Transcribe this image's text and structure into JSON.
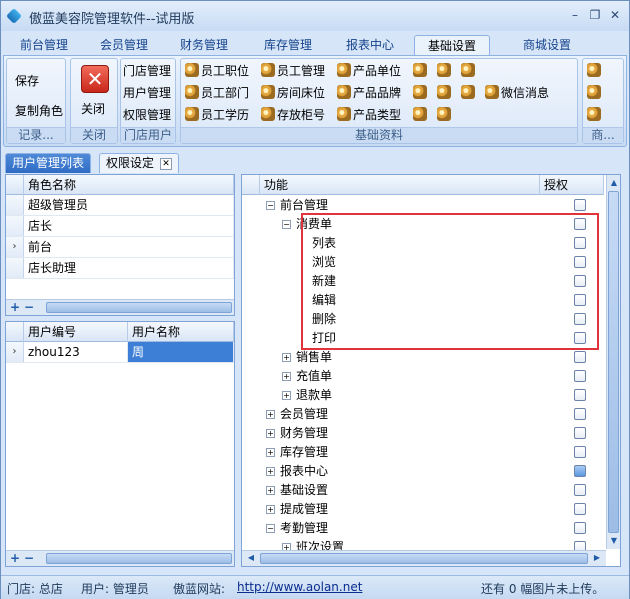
{
  "window": {
    "title": "傲蓝美容院管理软件--试用版",
    "minimize": "–",
    "restore": "❐",
    "close": "✕"
  },
  "ribbon_tabs": [
    "前台管理",
    "会员管理",
    "财务管理",
    "库存管理",
    "报表中心",
    "基础设置",
    "商城设置"
  ],
  "ribbon_active_tab": "基础设置",
  "ribbon": {
    "record_group": {
      "save": "保存",
      "copy_role": "复制角色",
      "label": "记录..."
    },
    "close_group": {
      "close": "关闭",
      "label": "关闭"
    },
    "store_group": {
      "items": [
        "门店管理",
        "用户管理",
        "权限管理"
      ],
      "label": "门店用户"
    },
    "basic_group": {
      "row1": [
        "员工职位",
        "员工管理",
        "产品单位",
        "",
        "",
        ""
      ],
      "row2": [
        "员工部门",
        "房间床位",
        "产品品牌",
        "",
        "",
        "微信消息"
      ],
      "row3": [
        "员工学历",
        "存放柜号",
        "产品类型",
        "",
        ""
      ],
      "label": "基础资料"
    },
    "mall_group": {
      "label": "商..."
    }
  },
  "doc_tabs": {
    "user_list": "用户管理列表",
    "permission": "权限设定"
  },
  "role_grid": {
    "header": "角色名称",
    "rows": [
      "超级管理员",
      "店长",
      "前台",
      "店长助理"
    ],
    "selected_marker": "›"
  },
  "user_grid": {
    "headers": [
      "用户编号",
      "用户名称"
    ],
    "rows": [
      {
        "code": "zhou123",
        "name": "周"
      }
    ]
  },
  "grid_controls": {
    "add": "+",
    "remove": "−"
  },
  "tree": {
    "headers": {
      "function": "功能",
      "auth": "授权"
    },
    "nodes": [
      {
        "label": "前台管理",
        "level": 0,
        "exp": "−"
      },
      {
        "label": "消费单",
        "level": 1,
        "exp": "−"
      },
      {
        "label": "列表",
        "level": 2,
        "exp": ""
      },
      {
        "label": "浏览",
        "level": 2,
        "exp": ""
      },
      {
        "label": "新建",
        "level": 2,
        "exp": ""
      },
      {
        "label": "编辑",
        "level": 2,
        "exp": ""
      },
      {
        "label": "删除",
        "level": 2,
        "exp": ""
      },
      {
        "label": "打印",
        "level": 2,
        "exp": ""
      },
      {
        "label": "销售单",
        "level": 1,
        "exp": "+"
      },
      {
        "label": "充值单",
        "level": 1,
        "exp": "+"
      },
      {
        "label": "退款单",
        "level": 1,
        "exp": "+"
      },
      {
        "label": "会员管理",
        "level": 0,
        "exp": "+"
      },
      {
        "label": "财务管理",
        "level": 0,
        "exp": "+"
      },
      {
        "label": "库存管理",
        "level": 0,
        "exp": "+"
      },
      {
        "label": "报表中心",
        "level": 0,
        "exp": "+"
      },
      {
        "label": "基础设置",
        "level": 0,
        "exp": "+"
      },
      {
        "label": "提成管理",
        "level": 0,
        "exp": "+"
      },
      {
        "label": "考勤管理",
        "level": 0,
        "exp": "−"
      },
      {
        "label": "班次设置",
        "level": 1,
        "exp": "+"
      }
    ]
  },
  "status": {
    "store": "门店: 总店",
    "user": "用户: 管理员",
    "site_label": "傲蓝网站:",
    "site_url": "http://www.aolan.net",
    "upload": "还有 0 幅图片未上传。"
  }
}
